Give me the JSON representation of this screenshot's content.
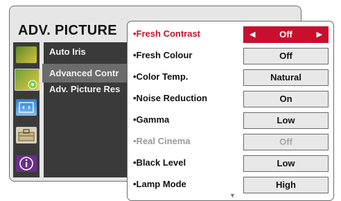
{
  "menu": {
    "title": "ADV. PICTURE",
    "items": [
      {
        "label": "Auto Iris"
      },
      {
        "label": "Advanced Contr"
      },
      {
        "label": "Adv. Picture Res"
      }
    ],
    "icons": [
      "picture-icon",
      "picture-settings-icon",
      "screen-icon",
      "setup-tools-icon",
      "info-icon"
    ]
  },
  "popup": {
    "rows": [
      {
        "label": "•Fresh Contrast",
        "value": "Off"
      },
      {
        "label": "•Fresh Colour",
        "value": "Off"
      },
      {
        "label": "•Color Temp.",
        "value": "Natural"
      },
      {
        "label": "•Noise Reduction",
        "value": "On"
      },
      {
        "label": "•Gamma",
        "value": "Low"
      },
      {
        "label": "•Real Cinema",
        "value": "Off"
      },
      {
        "label": "•Black Level",
        "value": "Low"
      },
      {
        "label": "•Lamp Mode",
        "value": "High"
      }
    ],
    "arrow_left": "◀",
    "arrow_right": "▶",
    "scroll_indicator": "▼"
  },
  "colors": {
    "accent": "#c8102e",
    "menu_dark": "#3a3a3a",
    "selected_list": "#6c6c6c"
  }
}
